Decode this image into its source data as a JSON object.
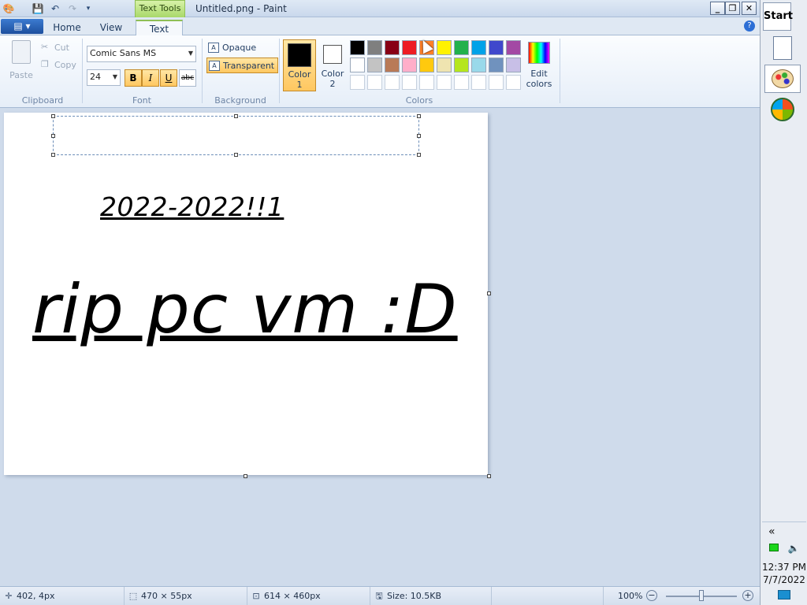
{
  "window": {
    "title": "Untitled.png - Paint",
    "context_tab": "Text Tools"
  },
  "tabs": [
    {
      "label": "Home"
    },
    {
      "label": "View"
    },
    {
      "label": "Text"
    }
  ],
  "clipboard": {
    "paste": "Paste",
    "cut": "Cut",
    "copy": "Copy",
    "label": "Clipboard"
  },
  "font": {
    "family": "Comic Sans MS",
    "size": "24",
    "bold": "B",
    "italic": "I",
    "underline": "U",
    "strike": "abc",
    "label": "Font"
  },
  "background": {
    "opaque": "Opaque",
    "transparent": "Transparent",
    "label": "Background"
  },
  "colors": {
    "color1_line1": "Color",
    "color1_line2": "1",
    "color2_line1": "Color",
    "color2_line2": "2",
    "edit_line1": "Edit",
    "edit_line2": "colors",
    "label": "Colors",
    "color1": "#000000",
    "color2": "#ffffff",
    "palette_row1": [
      "#000000",
      "#7f7f7f",
      "#880015",
      "#ed1c24",
      "#ff7f27",
      "#fff200",
      "#22b14c",
      "#00a2e8",
      "#3f48cc",
      "#a349a4"
    ],
    "palette_row2": [
      "#ffffff",
      "#c3c3c3",
      "#b97a57",
      "#ffaec9",
      "#ffc90e",
      "#efe4b0",
      "#b5e61d",
      "#99d9ea",
      "#7092be",
      "#c8bfe7"
    ]
  },
  "canvas": {
    "text1": "2022-2022!!1",
    "text2": "rip pc vm :D"
  },
  "status": {
    "cursor": "402, 4px",
    "selection": "470 × 55px",
    "image_size": "614 × 460px",
    "file_size": "Size: 10.5KB",
    "zoom": "100%"
  },
  "taskbar": {
    "start": "Start",
    "time": "12:37 PM",
    "date": "7/7/2022",
    "collapse": "«"
  }
}
